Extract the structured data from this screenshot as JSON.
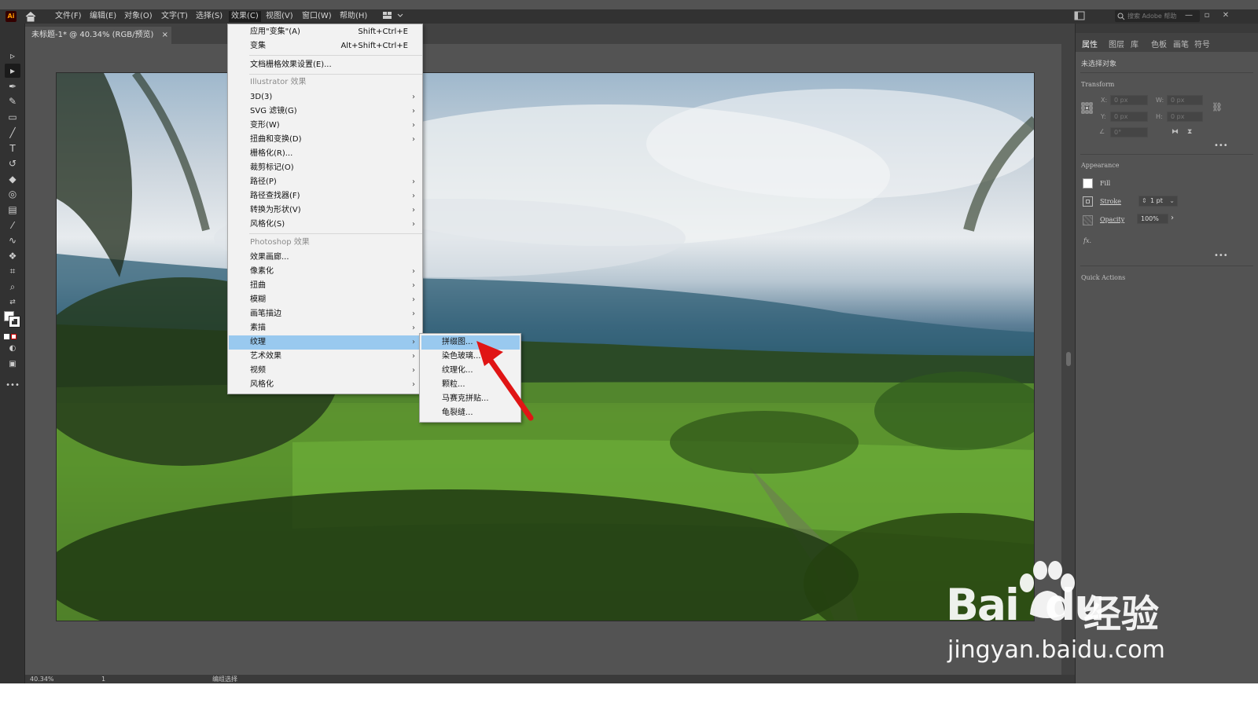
{
  "app": {
    "logo": "Ai"
  },
  "menubar": {
    "items": [
      "文件(F)",
      "编辑(E)",
      "对象(O)",
      "文字(T)",
      "选择(S)",
      "效果(C)",
      "视图(V)",
      "窗口(W)",
      "帮助(H)"
    ],
    "active": "效果(C)",
    "search_placeholder": "搜索 Adobe 帮助"
  },
  "document": {
    "tab_title": "未标题-1* @ 40.34% (RGB/预览)",
    "close_glyph": "×"
  },
  "status": {
    "zoom": "40.34%",
    "page": "1",
    "tool": "编组选择"
  },
  "effect_menu": {
    "apply_last": {
      "label": "应用\"变集\"(A)",
      "shortcut": "Shift+Ctrl+E"
    },
    "last_effect": {
      "label": "变集",
      "shortcut": "Alt+Shift+Ctrl+E"
    },
    "doc_raster_settings": "文档栅格效果设置(E)...",
    "illustrator_header": "Illustrator 效果",
    "illustrator_items": [
      "3D(3)",
      "SVG 滤镜(G)",
      "变形(W)",
      "扭曲和变换(D)",
      "栅格化(R)...",
      "裁剪标记(O)",
      "路径(P)",
      "路径查找器(F)",
      "转换为形状(V)",
      "风格化(S)"
    ],
    "photoshop_header": "Photoshop 效果",
    "photoshop_items": [
      "效果画廊...",
      "像素化",
      "扭曲",
      "模糊",
      "画笔描边",
      "素描",
      "纹理",
      "艺术效果",
      "视频",
      "风格化"
    ],
    "highlighted": "纹理"
  },
  "texture_submenu": {
    "items": [
      "拼缀图...",
      "染色玻璃...",
      "纹理化...",
      "颗粒...",
      "马赛克拼贴...",
      "龟裂缝..."
    ],
    "highlighted": "拼缀图..."
  },
  "right_panel": {
    "tabs": [
      "属性",
      "图层",
      "库",
      "色板",
      "画笔",
      "符号"
    ],
    "active_tab": "属性",
    "no_selection": "未选择对象",
    "transform": {
      "header": "Transform",
      "x_label": "X:",
      "y_label": "Y:",
      "w_label": "W:",
      "h_label": "H:",
      "x": "0 px",
      "y": "0 px",
      "w": "0 px",
      "h": "0 px",
      "angle": "0°"
    },
    "appearance": {
      "header": "Appearance",
      "fill_label": "Fill",
      "stroke_label": "Stroke",
      "stroke_weight": "1 pt",
      "opacity_label": "Opacity",
      "opacity_value": "100%",
      "fx": "fx."
    },
    "quick_actions": "Quick Actions"
  },
  "watermark": {
    "brand": "Bai",
    "brand2": "du",
    "cn": "经验",
    "url": "jingyan.baidu.com"
  },
  "colors": {
    "menu_bg": "#f2f2f2",
    "highlight": "#99c9ef",
    "arrow": "#e01515",
    "ui_dark": "#323232"
  }
}
